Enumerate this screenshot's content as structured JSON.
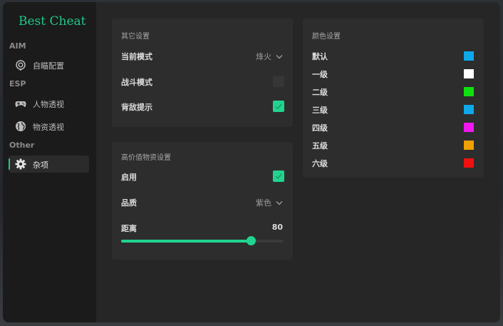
{
  "app": {
    "logo_text": "Best Cheat",
    "accent": "#20c98a"
  },
  "sidebar": {
    "sections": [
      {
        "label": "AIM",
        "items": [
          {
            "label": "自瞄配置",
            "icon": "target-icon",
            "active": false
          }
        ]
      },
      {
        "label": "ESP",
        "items": [
          {
            "label": "人物透视",
            "icon": "gamepad-icon",
            "active": false
          },
          {
            "label": "物资透视",
            "icon": "globe-icon",
            "active": false
          }
        ]
      },
      {
        "label": "Other",
        "items": [
          {
            "label": "杂项",
            "icon": "gear-icon",
            "active": true
          }
        ]
      }
    ]
  },
  "other_settings": {
    "title": "其它设置",
    "current_mode": {
      "label": "当前模式",
      "value": "烽火"
    },
    "battle_mode": {
      "label": "战斗模式",
      "checked": false
    },
    "back_alert": {
      "label": "背敌提示",
      "checked": true
    }
  },
  "loot_settings": {
    "title": "高价值物资设置",
    "enable": {
      "label": "启用",
      "checked": true
    },
    "quality": {
      "label": "品质",
      "value": "紫色"
    },
    "distance": {
      "label": "距离",
      "value": "80",
      "fill_fraction": 0.8
    }
  },
  "color_settings": {
    "title": "颜色设置",
    "items": [
      {
        "label": "默认",
        "color": "#10a8e8"
      },
      {
        "label": "一级",
        "color": "#ffffff"
      },
      {
        "label": "二级",
        "color": "#10e010"
      },
      {
        "label": "三级",
        "color": "#10a8e8"
      },
      {
        "label": "四级",
        "color": "#f018f0"
      },
      {
        "label": "五级",
        "color": "#f0a000"
      },
      {
        "label": "六级",
        "color": "#f01010"
      }
    ]
  }
}
